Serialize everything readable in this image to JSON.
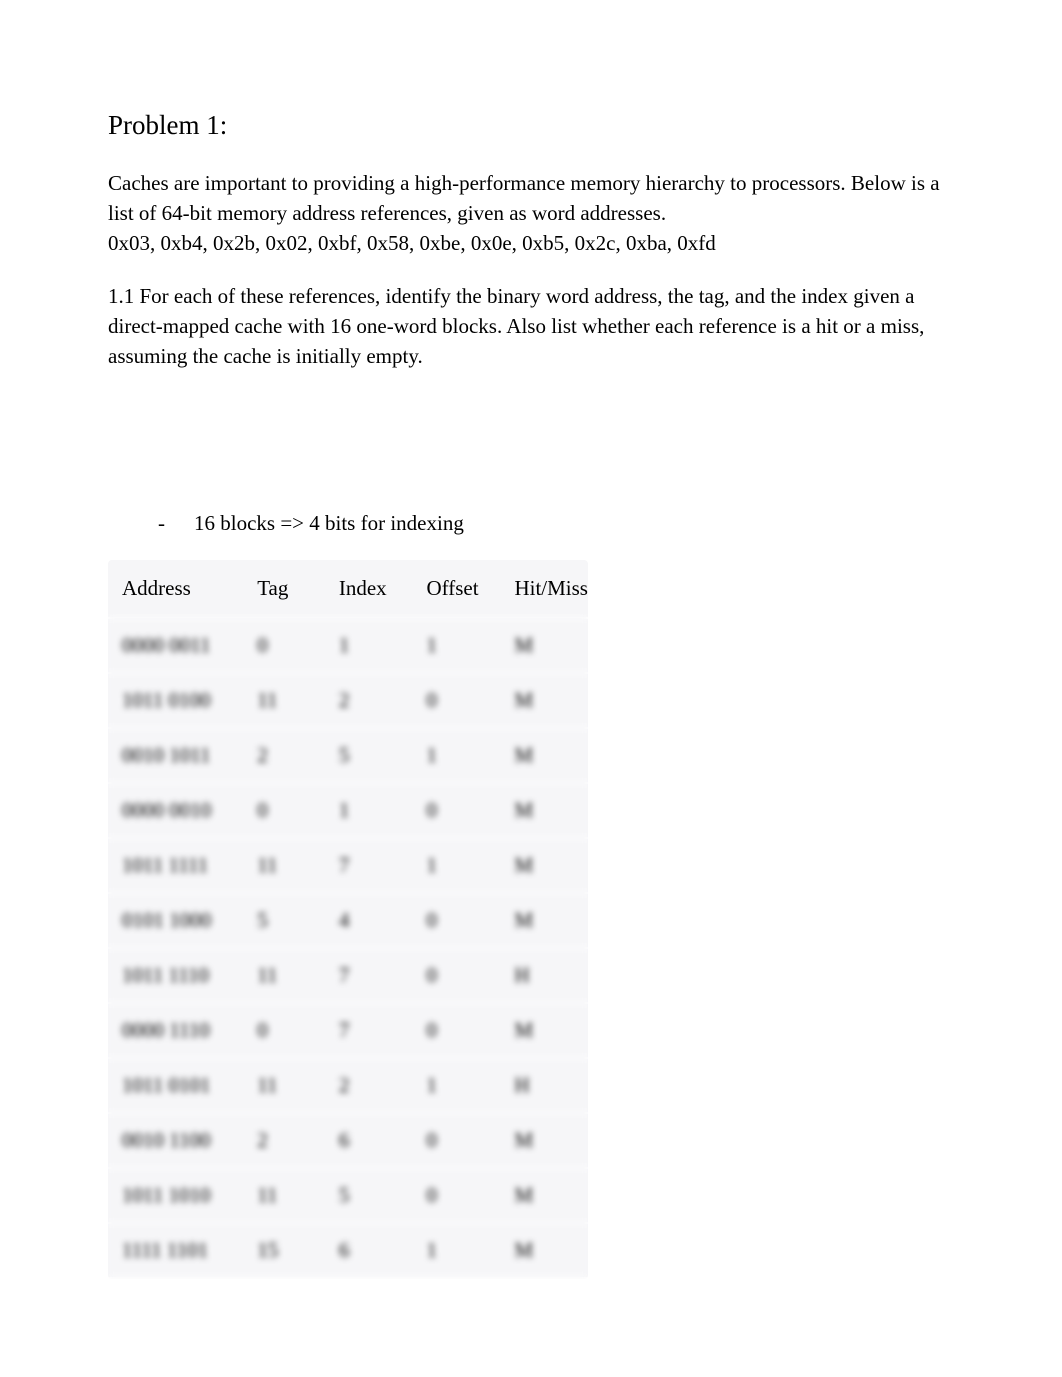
{
  "heading": "Problem 1:",
  "intro_p1": "Caches are important to providing a high-performance memory hierarchy to processors. Below is a list of 64-bit memory address references, given as word addresses.",
  "intro_p2": "0x03, 0xb4, 0x2b, 0x02, 0xbf, 0x58, 0xbe, 0x0e, 0xb5, 0x2c, 0xba, 0xfd",
  "question": "1.1   For each of these references, identify the binary word address, the tag, and the index given a direct-mapped cache with 16 one-word blocks. Also list whether each reference is a hit or a miss, assuming the cache is initially empty.",
  "bullet_dash": "-",
  "bullet_text": "16 blocks => 4 bits for indexing",
  "table": {
    "headers": {
      "address": "Address",
      "tag": "Tag",
      "index": "Index",
      "offset": "Offset",
      "hitmiss": "Hit/Miss"
    },
    "rows": [
      {
        "address": "0000 0011",
        "tag": "0",
        "index": "1",
        "offset": "1",
        "hitmiss": "M"
      },
      {
        "address": "1011 0100",
        "tag": "11",
        "index": "2",
        "offset": "0",
        "hitmiss": "M"
      },
      {
        "address": "0010 1011",
        "tag": "2",
        "index": "5",
        "offset": "1",
        "hitmiss": "M"
      },
      {
        "address": "0000 0010",
        "tag": "0",
        "index": "1",
        "offset": "0",
        "hitmiss": "M"
      },
      {
        "address": "1011 1111",
        "tag": "11",
        "index": "7",
        "offset": "1",
        "hitmiss": "M"
      },
      {
        "address": "0101 1000",
        "tag": "5",
        "index": "4",
        "offset": "0",
        "hitmiss": "M"
      },
      {
        "address": "1011 1110",
        "tag": "11",
        "index": "7",
        "offset": "0",
        "hitmiss": "H"
      },
      {
        "address": "0000 1110",
        "tag": "0",
        "index": "7",
        "offset": "0",
        "hitmiss": "M"
      },
      {
        "address": "1011 0101",
        "tag": "11",
        "index": "2",
        "offset": "1",
        "hitmiss": "H"
      },
      {
        "address": "0010 1100",
        "tag": "2",
        "index": "6",
        "offset": "0",
        "hitmiss": "M"
      },
      {
        "address": "1011 1010",
        "tag": "11",
        "index": "5",
        "offset": "0",
        "hitmiss": "M"
      },
      {
        "address": "1111 1101",
        "tag": "15",
        "index": "6",
        "offset": "1",
        "hitmiss": "M"
      }
    ]
  }
}
